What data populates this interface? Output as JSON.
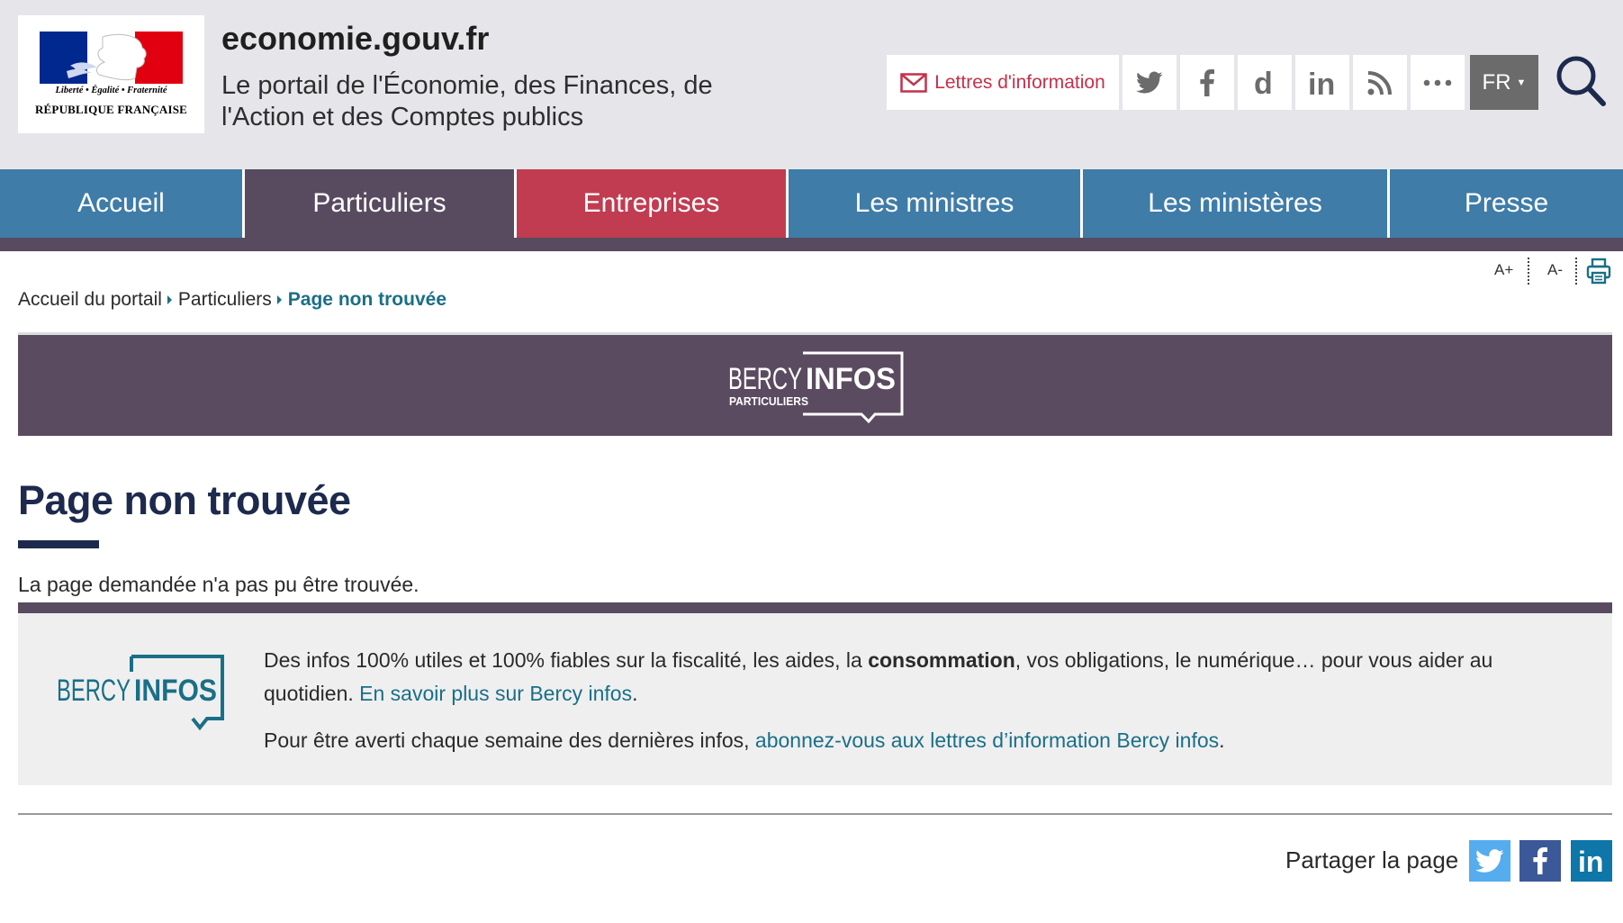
{
  "header": {
    "site_name": "economie.gouv.fr",
    "tagline": "Le portail de l'Économie, des Finances, de l'Action et des Comptes publics",
    "logo": {
      "devise": "Liberté • Égalité • Fraternité",
      "republique": "RÉPUBLIQUE FRANÇAISE"
    },
    "tools": {
      "newsletter_label": "Lettres d'information",
      "social_icons": [
        "twitter-icon",
        "facebook-icon",
        "dailymotion-icon",
        "linkedin-icon",
        "rss-icon",
        "more-icon"
      ],
      "language": "FR",
      "search_icon": "search-icon"
    }
  },
  "nav": {
    "items": [
      {
        "label": "Accueil",
        "color": "#3f7ca8"
      },
      {
        "label": "Particuliers",
        "color": "#584b60"
      },
      {
        "label": "Entreprises",
        "color": "#c13c50"
      },
      {
        "label": "Les ministres",
        "color": "#3f7ca8"
      },
      {
        "label": "Les ministères",
        "color": "#3f7ca8"
      },
      {
        "label": "Presse",
        "color": "#3f7ca8"
      }
    ]
  },
  "accessibility": {
    "increase_font": "A+",
    "decrease_font": "A-",
    "print_icon": "print-icon"
  },
  "breadcrumb": {
    "items": [
      "Accueil du portail",
      "Particuliers"
    ],
    "current": "Page non trouvée"
  },
  "banner": {
    "brand_left": "BERCY",
    "brand_right": "INFOS",
    "subtitle": "PARTICULIERS"
  },
  "main": {
    "title": "Page non trouvée",
    "message": "La page demandée n'a pas pu être trouvée."
  },
  "info_box": {
    "logo_left": "BERCY",
    "logo_right": "INFOS",
    "p1_before": "Des infos 100% utiles et 100% fiables sur la fiscalité, les aides, la ",
    "p1_bold": "consommation",
    "p1_after": ", vos obligations, le numérique… pour vous aider au quotidien. ",
    "p1_link": "En savoir plus sur Bercy infos",
    "p1_end": ".",
    "p2_before": "Pour être averti chaque semaine des dernières infos, ",
    "p2_link": "abonnez-vous aux lettres d’information Bercy infos",
    "p2_end": "."
  },
  "share": {
    "label": "Partager la page",
    "buttons": [
      {
        "icon": "twitter-icon",
        "color": "#55acee"
      },
      {
        "icon": "facebook-icon",
        "color": "#3b5998"
      },
      {
        "icon": "linkedin-icon",
        "color": "#0e76a8"
      }
    ]
  },
  "colors": {
    "accent_teal": "#1a6f86",
    "newsletter_red": "#c4314b",
    "title_navy": "#1d2a4d",
    "purple_bar": "#584b60"
  }
}
